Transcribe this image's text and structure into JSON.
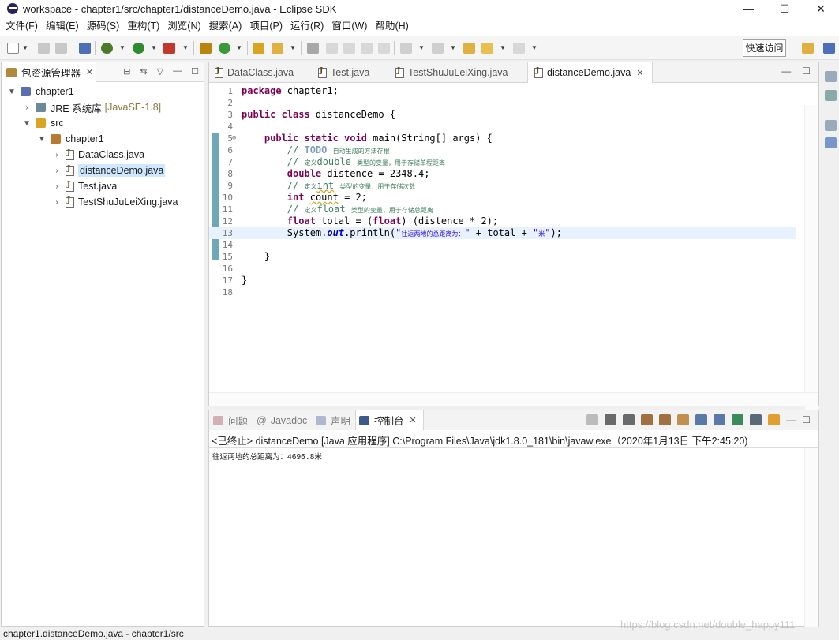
{
  "window": {
    "title": "workspace - chapter1/src/chapter1/distanceDemo.java - Eclipse SDK",
    "minimize": "—",
    "maximize": "☐",
    "close": "✕"
  },
  "menu": [
    "文件(F)",
    "编辑(E)",
    "源码(S)",
    "重构(T)",
    "浏览(N)",
    "搜索(A)",
    "项目(P)",
    "运行(R)",
    "窗口(W)",
    "帮助(H)"
  ],
  "toolbar": {
    "quick_access": "快速访问",
    "icons": [
      "new-icon",
      "save-icon",
      "save-all-icon",
      "skip-breakpoints-icon",
      "debug-icon",
      "run-icon",
      "external-tools-icon",
      "new-java-package-icon",
      "new-class-icon",
      "open-type-icon",
      "search-icon",
      "annotation-icon",
      "back-icon",
      "forward-icon"
    ],
    "accent_colors": {
      "run": "#2e8b2e",
      "debug": "#4a7a2a",
      "tools": "#c0392b",
      "new_class": "#d9a520"
    }
  },
  "explorer": {
    "tab_label": "包资源管理器",
    "tree": [
      {
        "label": "chapter1",
        "icon": "java-project-icon",
        "depth": 0,
        "expanded": true
      },
      {
        "label": "JRE 系统库",
        "decoration": "[JavaSE-1.8]",
        "icon": "library-icon",
        "depth": 1,
        "expanded": false
      },
      {
        "label": "src",
        "icon": "source-folder-icon",
        "depth": 1,
        "expanded": true
      },
      {
        "label": "chapter1",
        "icon": "package-icon",
        "depth": 2,
        "expanded": true
      },
      {
        "label": "DataClass.java",
        "icon": "java-file-icon",
        "depth": 3,
        "expanded": false
      },
      {
        "label": "distanceDemo.java",
        "icon": "java-file-icon",
        "depth": 3,
        "expanded": false,
        "selected": true
      },
      {
        "label": "Test.java",
        "icon": "java-file-icon",
        "depth": 3,
        "expanded": false
      },
      {
        "label": "TestShuJuLeiXing.java",
        "icon": "java-file-icon",
        "depth": 3,
        "expanded": false
      }
    ]
  },
  "editor": {
    "tabs": [
      {
        "label": "DataClass.java",
        "active": false
      },
      {
        "label": "Test.java",
        "active": false
      },
      {
        "label": "TestShuJuLeiXing.java",
        "active": false
      },
      {
        "label": "distanceDemo.java",
        "active": true
      }
    ],
    "lines": [
      {
        "n": "1",
        "t": "package chapter1;"
      },
      {
        "n": "2",
        "t": ""
      },
      {
        "n": "3",
        "t": "public class distanceDemo {"
      },
      {
        "n": "4",
        "t": ""
      },
      {
        "n": "5",
        "t": "    public static void main(String[] args) {"
      },
      {
        "n": "6",
        "t": "        // TODO 自动生成的方法存根"
      },
      {
        "n": "7",
        "t": "        // 定义double 类型的变量，用于存储单程距离"
      },
      {
        "n": "8",
        "t": "        double distence = 2348.4;"
      },
      {
        "n": "9",
        "t": "        // 定义int 类型的变量，用于存储次数"
      },
      {
        "n": "10",
        "t": "        int count = 2;"
      },
      {
        "n": "11",
        "t": "        // 定义float 类型的变量，用于存储总距离"
      },
      {
        "n": "12",
        "t": "        float total = (float) (distence * 2);"
      },
      {
        "n": "13",
        "t": "        System.out.println(\"往返两地的总距离为：\" + total + \"米\");"
      },
      {
        "n": "14",
        "t": ""
      },
      {
        "n": "15",
        "t": "    }"
      },
      {
        "n": "16",
        "t": ""
      },
      {
        "n": "17",
        "t": "}"
      },
      {
        "n": "18",
        "t": ""
      }
    ],
    "current_line": "13",
    "syntax_colors": {
      "keyword": "#7f0055",
      "comment": "#3f7f5f",
      "string": "#2a00ff",
      "field": "#0000c0",
      "todo": "#7f9fbf"
    }
  },
  "console": {
    "tabs": [
      {
        "label": "问题",
        "active": false
      },
      {
        "label": "Javadoc",
        "active": false
      },
      {
        "label": "声明",
        "active": false
      },
      {
        "label": "控制台",
        "active": true
      }
    ],
    "header": "<已终止> distanceDemo [Java 应用程序] C:\\Program Files\\Java\\jdk1.8.0_181\\bin\\javaw.exe（2020年1月13日 下午2:45:20)",
    "output": "往返两地的总距离为：4696.8米"
  },
  "status": {
    "text": "chapter1.distanceDemo.java - chapter1/src"
  },
  "watermark": "https://blog.csdn.net/double_happy111"
}
